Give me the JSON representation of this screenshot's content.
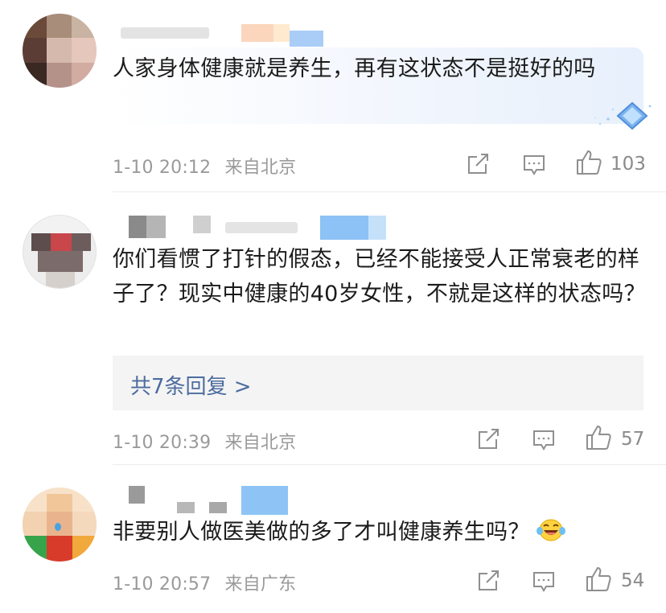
{
  "comments": [
    {
      "text": "人家身体健康就是养生，再有这状态不是挺好的吗",
      "date": "1-10 20:12",
      "location": "来自北京",
      "likes": "103",
      "share_icon": "share-icon",
      "reply_icon": "comment-icon",
      "like_icon": "thumbs-up-icon",
      "badge_icon": "diamond-badge-icon"
    },
    {
      "text": "你们看惯了打针的假态，已经不能接受人正常衰老的样子了？现实中健康的40岁女性，不就是这样的状态吗？",
      "date": "1-10 20:39",
      "location": "来自北京",
      "likes": "57",
      "replies_label": "共7条回复 >"
    },
    {
      "text": "非要别人做医美做的多了才叫健康养生吗？",
      "date": "1-10 20:57",
      "location": "来自广东",
      "likes": "54",
      "emoji_icon": "laughing-tears-emoji-icon"
    }
  ],
  "colors": {
    "text": "#1b1b1b",
    "meta": "#9a9a9a",
    "link": "#4c6c9e",
    "reply_bg": "#f4f4f4"
  }
}
